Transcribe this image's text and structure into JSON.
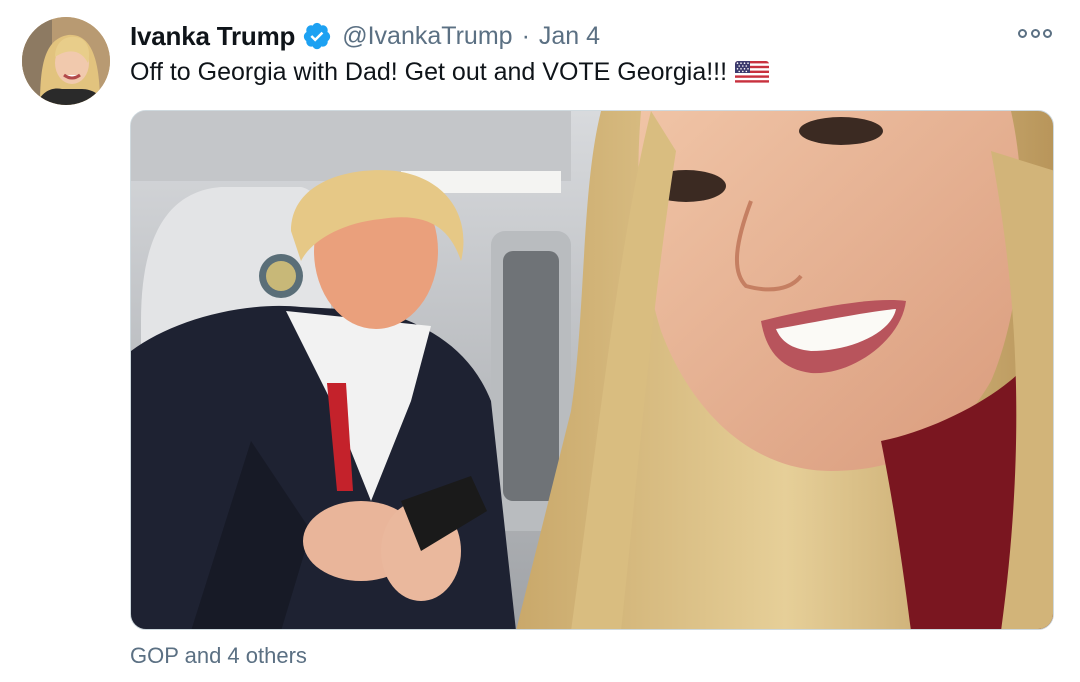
{
  "tweet": {
    "author": {
      "display_name": "Ivanka Trump",
      "handle": "@IvankaTrump",
      "verified": true
    },
    "separator": "·",
    "timestamp": "Jan 4",
    "text": "Off to Georgia with Dad! Get out and VOTE Georgia!!!",
    "emoji": "us-flag-emoji",
    "media": {
      "type": "photo",
      "icon": "photo"
    },
    "footer": "GOP and 4 others"
  },
  "colors": {
    "text_primary": "#0f1419",
    "text_secondary": "#5b7083",
    "verified_blue": "#1da1f2",
    "border": "#cfd9de"
  },
  "icons": {
    "verified": "verified-badge-icon",
    "more": "more-options-icon"
  }
}
